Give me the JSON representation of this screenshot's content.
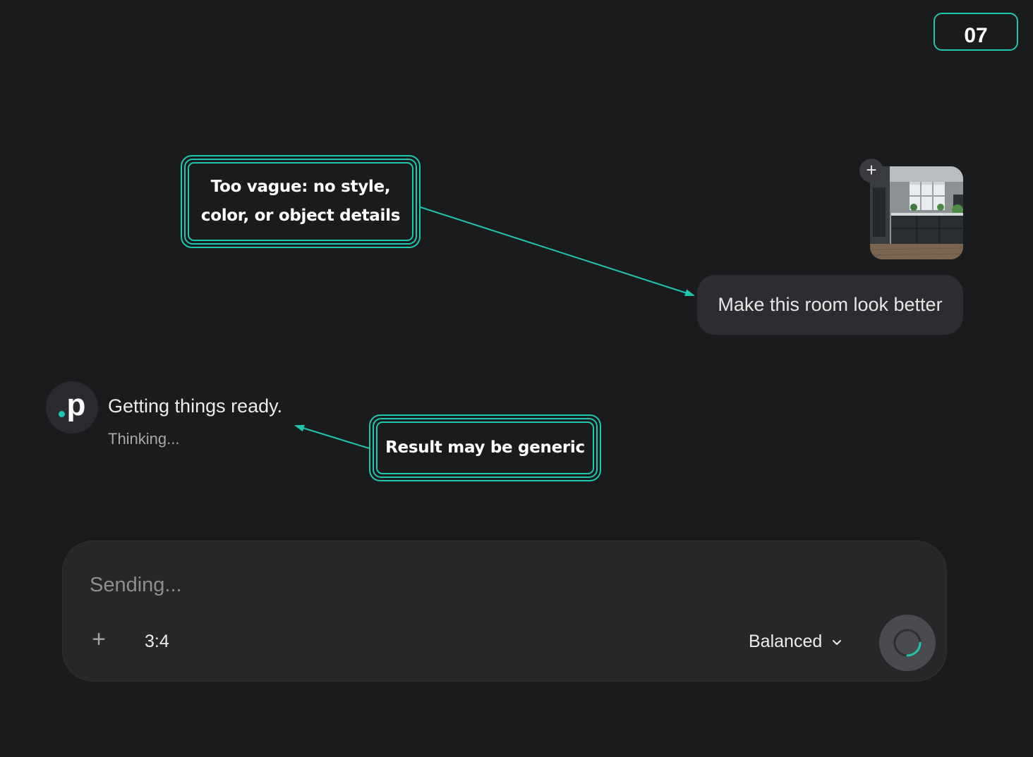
{
  "step_badge": "07",
  "annotations": {
    "vague_prompt": "Too vague: no style,\ncolor, or object details",
    "generic_result": "Result may be generic"
  },
  "chat": {
    "user_message": "Make this room look better",
    "attachment_add_icon": "plus-icon",
    "assistant": {
      "avatar_letter": "p",
      "status": "Getting things ready.",
      "substatus": "Thinking..."
    }
  },
  "composer": {
    "placeholder": "Sending...",
    "add_icon": "plus-icon",
    "aspect_ratio": "3:4",
    "mode": "Balanced",
    "send_icon": "loading-spinner-icon"
  },
  "colors": {
    "background": "#1a1b1d",
    "accent": "#1fc7b0",
    "bubble": "#2c2d30",
    "composer": "#262729"
  }
}
